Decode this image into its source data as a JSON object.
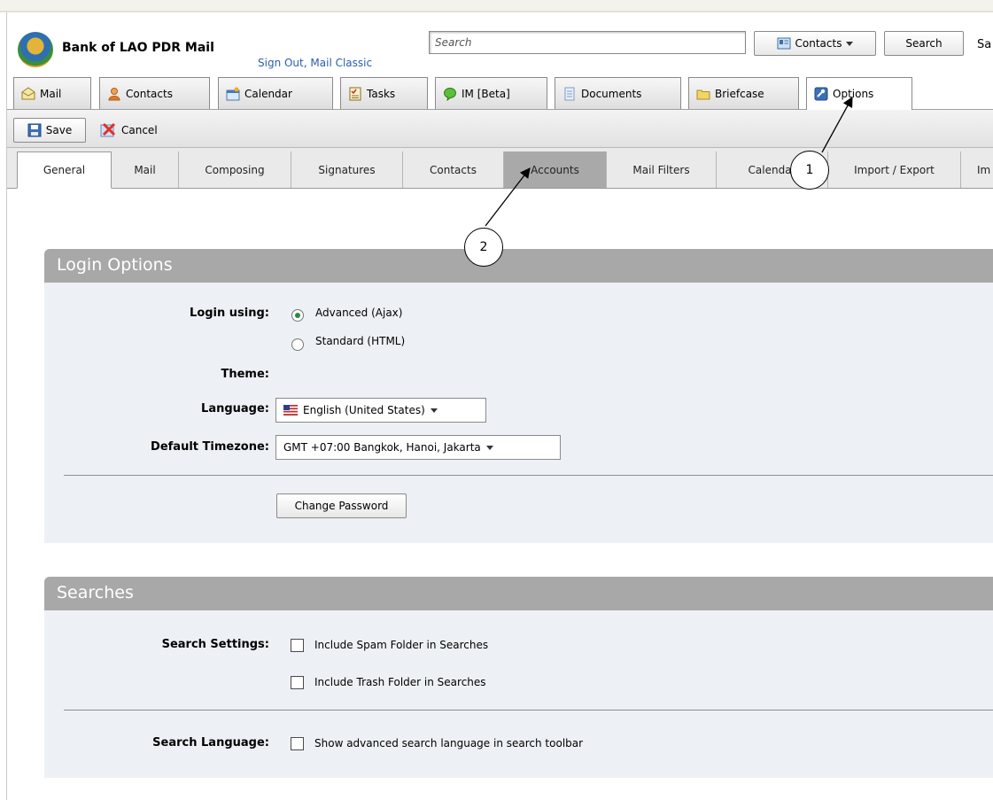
{
  "brand": {
    "title": "Bank of LAO PDR Mail"
  },
  "header_links": {
    "sign_out": "Sign Out",
    "separator": ",",
    "mail_classic": "Mail Classic"
  },
  "search": {
    "placeholder": "Search",
    "scope_label": "Contacts",
    "button_label": "Search",
    "truncated_label": "Sa"
  },
  "app_tabs": [
    {
      "label": "Mail",
      "icon": "envelope-icon"
    },
    {
      "label": "Contacts",
      "icon": "person-icon"
    },
    {
      "label": "Calendar",
      "icon": "calendar-icon"
    },
    {
      "label": "Tasks",
      "icon": "tasks-icon"
    },
    {
      "label": "IM [Beta]",
      "icon": "chat-bubble-icon"
    },
    {
      "label": "Documents",
      "icon": "document-icon"
    },
    {
      "label": "Briefcase",
      "icon": "folder-icon"
    },
    {
      "label": "Options",
      "icon": "options-icon",
      "active": true
    }
  ],
  "toolbar": {
    "save_label": "Save",
    "cancel_label": "Cancel"
  },
  "sub_tabs": [
    {
      "label": "General",
      "active": true
    },
    {
      "label": "Mail"
    },
    {
      "label": "Composing"
    },
    {
      "label": "Signatures"
    },
    {
      "label": "Contacts"
    },
    {
      "label": "Accounts",
      "highlighted": true
    },
    {
      "label": "Mail Filters"
    },
    {
      "label": "Calendar"
    },
    {
      "label": "Import / Export"
    },
    {
      "label": "Im"
    }
  ],
  "login_options": {
    "heading": "Login Options",
    "login_using_label": "Login using:",
    "login_choices": [
      {
        "label": "Advanced (Ajax)",
        "selected": true
      },
      {
        "label": "Standard (HTML)",
        "selected": false
      }
    ],
    "theme_label": "Theme:",
    "language_label": "Language:",
    "language_value": "English (United States)",
    "timezone_label": "Default Timezone:",
    "timezone_value": "GMT +07:00 Bangkok, Hanoi, Jakarta",
    "change_password_label": "Change Password"
  },
  "searches": {
    "heading": "Searches",
    "search_settings_label": "Search Settings:",
    "include_spam": {
      "label": "Include Spam Folder in Searches",
      "checked": false
    },
    "include_trash": {
      "label": "Include Trash Folder in Searches",
      "checked": false
    },
    "search_language_label": "Search Language:",
    "advanced_language": {
      "label": "Show advanced search language in search toolbar",
      "checked": false
    }
  },
  "annotations": [
    {
      "number": "1",
      "target": "Options tab"
    },
    {
      "number": "2",
      "target": "Accounts tab"
    }
  ],
  "colors": {
    "link": "#2a5db0",
    "panel_header": "#a8a8a8",
    "panel_body": "#edf1f5",
    "highlight_tab": "#a9a9a9"
  }
}
